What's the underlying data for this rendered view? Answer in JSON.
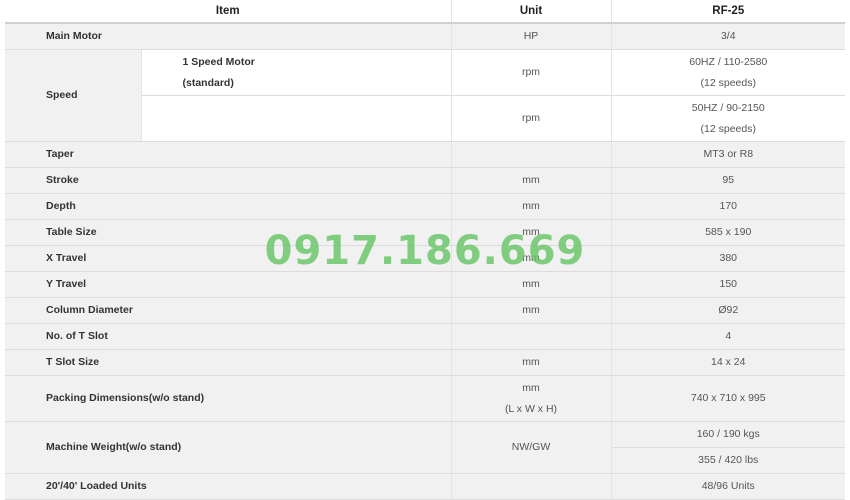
{
  "header": {
    "item": "Item",
    "unit": "Unit",
    "model": "RF-25"
  },
  "rows": {
    "main_motor": {
      "label": "Main Motor",
      "unit": "HP",
      "value": "3/4"
    },
    "speed": {
      "label": "Speed",
      "sub_label_line1": "1 Speed Motor",
      "sub_label_line2": "(standard)",
      "row1": {
        "unit": "rpm",
        "value_line1": "60HZ / 110-2580",
        "value_line2": "(12 speeds)"
      },
      "row2": {
        "unit": "rpm",
        "value_line1": "50HZ / 90-2150",
        "value_line2": "(12 speeds)"
      }
    },
    "taper": {
      "label": "Taper",
      "unit": "",
      "value": "MT3 or R8"
    },
    "stroke": {
      "label": "Stroke",
      "unit": "mm",
      "value": "95"
    },
    "depth": {
      "label": "Depth",
      "unit": "mm",
      "value": "170"
    },
    "table_size": {
      "label": "Table Size",
      "unit": "mm",
      "value": "585 x 190"
    },
    "x_travel": {
      "label": "X Travel",
      "unit": "mm",
      "value": "380"
    },
    "y_travel": {
      "label": "Y Travel",
      "unit": "mm",
      "value": "150"
    },
    "column_diameter": {
      "label": "Column Diameter",
      "unit": "mm",
      "value": "Ø92"
    },
    "t_slot_count": {
      "label": "No. of T Slot",
      "unit": "",
      "value": "4"
    },
    "t_slot_size": {
      "label": "T Slot Size",
      "unit": "mm",
      "value": "14 x 24"
    },
    "packing": {
      "label": "Packing Dimensions(w/o stand)",
      "unit_line1": "mm",
      "unit_line2": "(L x W x H)",
      "value": "740 x 710 x 995"
    },
    "weight": {
      "label": "Machine Weight(w/o stand)",
      "unit": "NW/GW",
      "value1": "160 / 190 kgs",
      "value2": "355 / 420 lbs"
    },
    "loaded_units": {
      "label": "20'/40' Loaded Units",
      "unit": "",
      "value": "48/96 Units"
    }
  },
  "watermark": "0917.186.669"
}
